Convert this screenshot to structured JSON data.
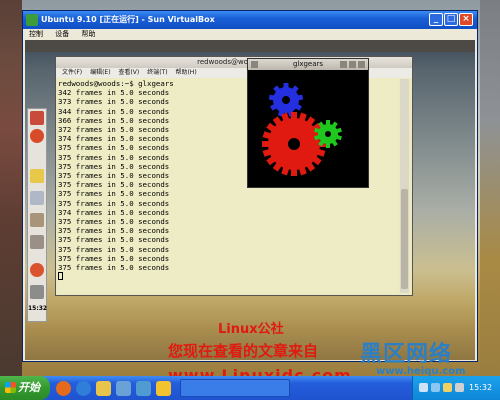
{
  "vbox": {
    "title": "Ubuntu 9.10 [正在运行] - Sun VirtualBox",
    "menu": [
      "控制",
      "设备",
      "帮助"
    ]
  },
  "terminal": {
    "title": "redwoods@woods: ~",
    "menu": [
      "文件(F)",
      "编辑(E)",
      "查看(V)",
      "终端(T)",
      "帮助(H)"
    ],
    "prompt": "redwoods@woods:~$ glxgears",
    "lines": [
      "342 frames in 5.0 seconds",
      "373 frames in 5.0 seconds",
      "344 frames in 5.0 seconds",
      "366 frames in 5.0 seconds",
      "372 frames in 5.0 seconds",
      "374 frames in 5.0 seconds",
      "375 frames in 5.0 seconds",
      "375 frames in 5.0 seconds",
      "375 frames in 5.0 seconds",
      "375 frames in 5.0 seconds",
      "375 frames in 5.0 seconds",
      "375 frames in 5.0 seconds",
      "375 frames in 5.0 seconds",
      "374 frames in 5.0 seconds",
      "375 frames in 5.0 seconds",
      "375 frames in 5.0 seconds",
      "375 frames in 5.0 seconds",
      "375 frames in 5.0 seconds",
      "375 frames in 5.0 seconds",
      "375 frames in 5.0 seconds"
    ]
  },
  "glxgears": {
    "title": "glxgears",
    "gear_colors": {
      "blue": "#2430e0",
      "red": "#e01a10",
      "green": "#1ec81e"
    }
  },
  "dock": {
    "time": "15:32"
  },
  "watermark": {
    "line1": "Linux公社",
    "line2": "您现在查看的文章来自",
    "url": "www.Linuxidc.com",
    "logo": "黑区网络",
    "logo_url": "www.heiqu.com"
  },
  "taskbar": {
    "start_label": "开始",
    "clock": "15:32",
    "quick_launch": [
      "firefox-icon",
      "ie-icon",
      "folder-icon",
      "app-icon",
      "app-icon",
      "virtualbox-icon"
    ]
  },
  "colors": {
    "taskbar": "#245edb",
    "start_green": "#33992e",
    "watermark_red": "#e01a10",
    "logo_blue": "#2a7fc6"
  }
}
